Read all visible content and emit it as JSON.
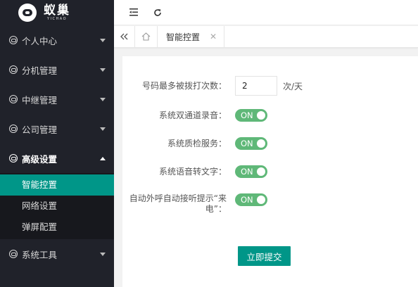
{
  "app": {
    "logo_name": "蚁巢",
    "logo_sub": "YICHAO"
  },
  "sidebar": {
    "items": [
      {
        "label": "个人中心"
      },
      {
        "label": "分机管理"
      },
      {
        "label": "中继管理"
      },
      {
        "label": "公司管理"
      },
      {
        "label": "高级设置",
        "expanded": true
      },
      {
        "label": "系统工具"
      }
    ],
    "submenu": [
      {
        "label": "智能控置",
        "active": true
      },
      {
        "label": "网络设置"
      },
      {
        "label": "弹屏配置"
      }
    ]
  },
  "topbar": {
    "collapse_icon": "menu-collapse-icon",
    "refresh_icon": "refresh-icon"
  },
  "tabs": {
    "prev_icon": "double-chevron-left-icon",
    "home_icon": "home-icon",
    "items": [
      {
        "label": "智能控置",
        "active": true
      }
    ]
  },
  "form": {
    "max_redial": {
      "label": "号码最多被拨打次数：",
      "value": "2",
      "unit": "次/天"
    },
    "dual_record": {
      "label": "系统双通道录音：",
      "state": "ON"
    },
    "qc_service": {
      "label": "系统质检服务：",
      "state": "ON"
    },
    "asr": {
      "label": "系统语音转文字：",
      "state": "ON"
    },
    "auto_answer": {
      "label": "自动外呼自动接听提示“来电”：",
      "state": "ON"
    },
    "submit_label": "立即提交"
  },
  "colors": {
    "sidebar_bg": "#20222a",
    "accent": "#009688",
    "switch_on": "#5fb878"
  }
}
